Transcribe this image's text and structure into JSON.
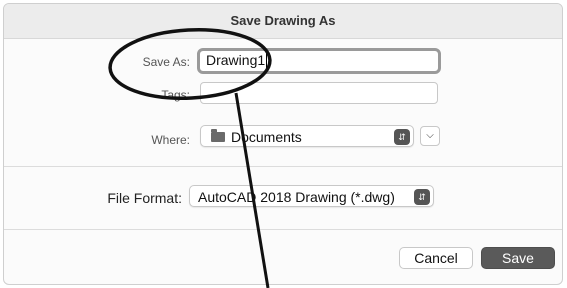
{
  "dialog": {
    "title": "Save Drawing As"
  },
  "form": {
    "save_as_label": "Save As:",
    "save_as_value": "Drawing1",
    "tags_label": "Tags:",
    "tags_value": "",
    "where_label": "Where:",
    "where_value": "Documents",
    "where_icon": "folder-icon",
    "file_format_label": "File Format:",
    "file_format_value": "AutoCAD 2018 Drawing (*.dwg)"
  },
  "buttons": {
    "cancel_label": "Cancel",
    "save_label": "Save"
  },
  "colors": {
    "save_button": "#5a5a5a",
    "annotation": "#111111"
  }
}
